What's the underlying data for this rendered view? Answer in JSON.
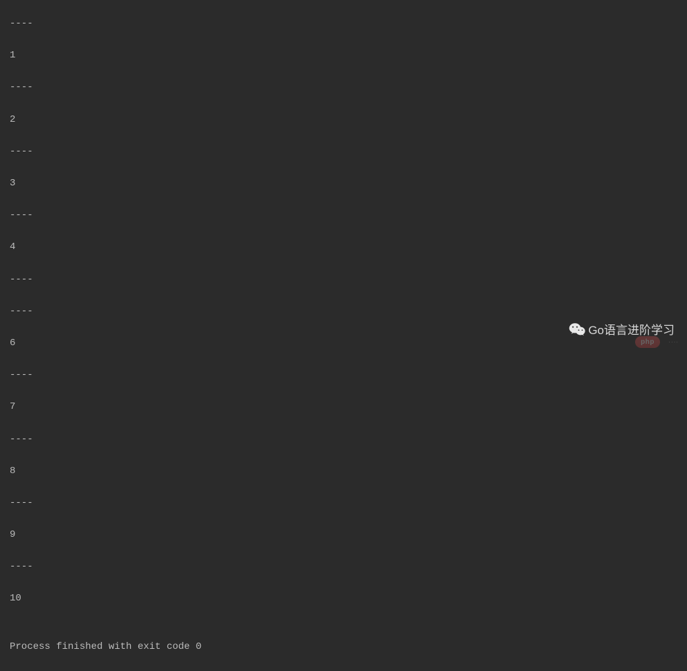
{
  "console": {
    "lines": [
      "----",
      "1",
      "----",
      "2",
      "----",
      "3",
      "----",
      "4",
      "----",
      "----",
      "6",
      "----",
      "7",
      "----",
      "8",
      "----",
      "9",
      "----",
      "10",
      "",
      "Process finished with exit code 0"
    ]
  },
  "badge": {
    "text": "Go语言进阶学习"
  },
  "watermark": {
    "pill": "php",
    "sub": "····"
  }
}
